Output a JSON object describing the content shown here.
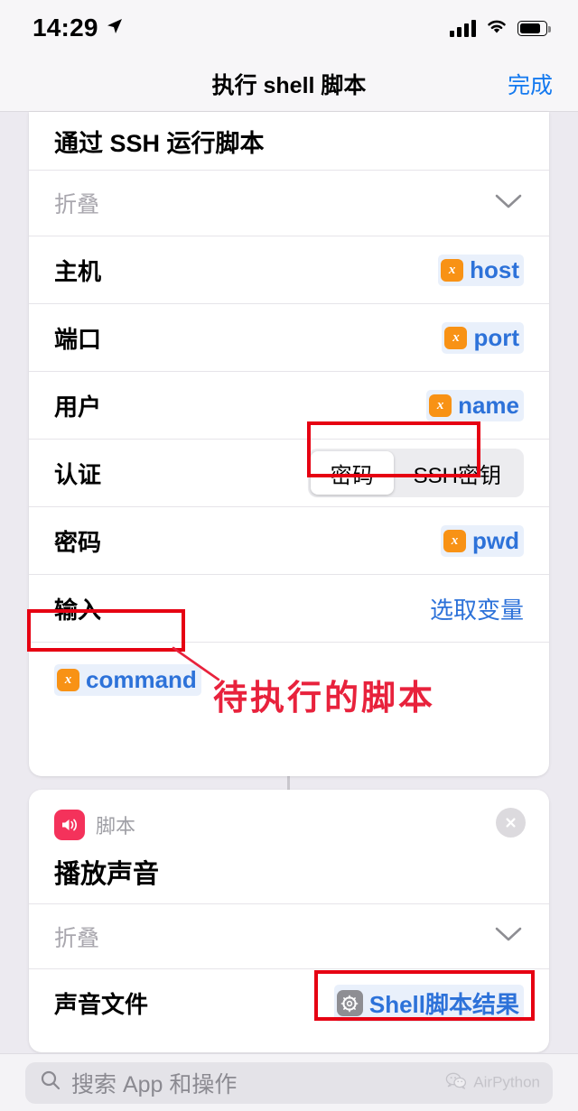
{
  "status_bar": {
    "time": "14:29",
    "location_icon": "location-arrow-icon",
    "signal_icon": "cellular-signal-icon",
    "wifi_icon": "wifi-icon",
    "battery_icon": "battery-icon"
  },
  "nav": {
    "title": "执行 shell 脚本",
    "done_label": "完成"
  },
  "action_ssh": {
    "title": "通过 SSH 运行脚本",
    "collapse_label": "折叠",
    "rows": [
      {
        "label": "主机",
        "value": "host",
        "value_type": "variable"
      },
      {
        "label": "端口",
        "value": "port",
        "value_type": "variable"
      },
      {
        "label": "用户",
        "value": "name",
        "value_type": "variable"
      }
    ],
    "auth": {
      "label": "认证",
      "options": [
        "密码",
        "SSH密钥"
      ],
      "selected": "密码"
    },
    "password": {
      "label": "密码",
      "value": "pwd",
      "value_type": "variable"
    },
    "input": {
      "label": "输入",
      "value": "选取变量",
      "value_type": "link"
    },
    "script_token": {
      "value": "command",
      "value_type": "variable"
    }
  },
  "action_sound": {
    "kind": "脚本",
    "title": "播放声音",
    "collapse_label": "折叠",
    "sound_file": {
      "label": "声音文件",
      "value": "Shell脚本结果",
      "icon": "gear-icon"
    },
    "close_icon": "close-icon"
  },
  "annotations": {
    "note_text": "待执行的脚本",
    "box_color": "#e60012",
    "text_color": "#e8223c"
  },
  "bottom": {
    "search_placeholder": "搜索 App 和操作",
    "search_icon": "search-icon",
    "watermark_text": "AirPython",
    "watermark_icon": "wechat-icon"
  },
  "colors": {
    "accent_blue": "#2d72d9",
    "nav_blue": "#1479ef",
    "variable_orange": "#f89215",
    "sound_red": "#f4325b",
    "page_bg": "#eceaf0"
  }
}
